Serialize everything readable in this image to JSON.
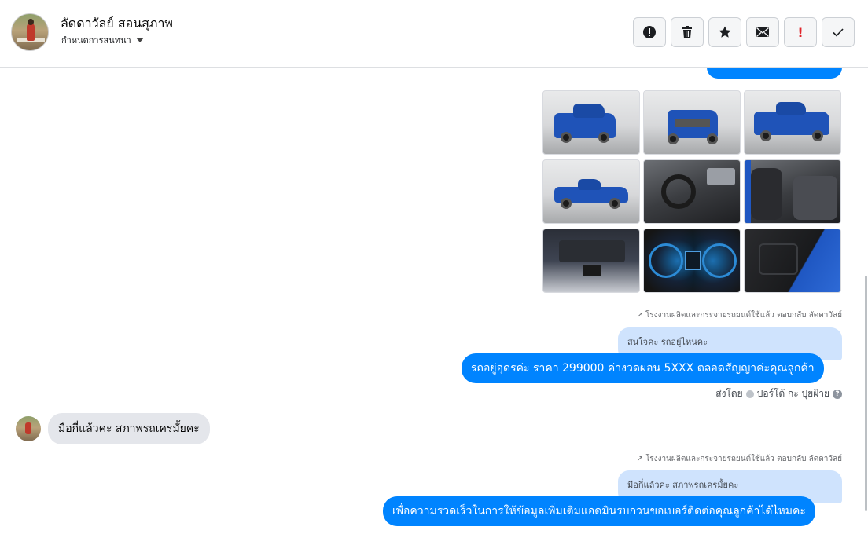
{
  "header": {
    "name": "ลัดดาวัลย์ สอนสุภาพ",
    "assign_label": "กำหนดการสนทนา",
    "toolbar": [
      {
        "name": "spam-alert-button",
        "icon": "alert-circle-icon",
        "glyph": "!"
      },
      {
        "name": "delete-button",
        "icon": "trash-icon",
        "glyph": ""
      },
      {
        "name": "star-button",
        "icon": "star-icon",
        "glyph": "★"
      },
      {
        "name": "mark-unread-button",
        "icon": "envelope-icon",
        "glyph": ""
      },
      {
        "name": "follow-up-button",
        "icon": "exclamation-icon",
        "glyph": "!"
      },
      {
        "name": "done-button",
        "icon": "check-icon",
        "glyph": "✓"
      }
    ]
  },
  "messages": {
    "photo_count": 9,
    "reply1": {
      "meta": "โรงงานผลิตและกระจายรถยนต์ใช้แล้ว ตอบกลับ ลัดดาวัลย์",
      "quote": "สนใจคะ รถอยู่ไหนคะ",
      "text": "รถอยู่อุดรค่ะ ราคา 299000  ค่างวดผ่อน 5XXX ตลอดสัญญาค่ะคุณลูกค้า"
    },
    "sent_by": {
      "prefix": "ส่งโดย",
      "agent": "ปอร์โต้ กะ ปุยฝ้าย"
    },
    "incoming": {
      "text": "มือกี่แล้วคะ สภาพรถเครมั้ยคะ"
    },
    "reply2": {
      "meta": "โรงงานผลิตและกระจายรถยนต์ใช้แล้ว ตอบกลับ ลัดดาวัลย์",
      "quote": "มือกี่แล้วคะ สภาพรถเครมั้ยคะ",
      "text": "เพื่อความรวดเร็วในการให้ข้อมูลเพิ่มเติมแอดมินรบกวนขอเบอร์ติดต่อคุณลูกค้าได้ไหมคะ"
    }
  },
  "colors": {
    "accent": "#0084ff",
    "quote_bg": "#cfe3fd",
    "incoming_bg": "#e4e6eb"
  }
}
